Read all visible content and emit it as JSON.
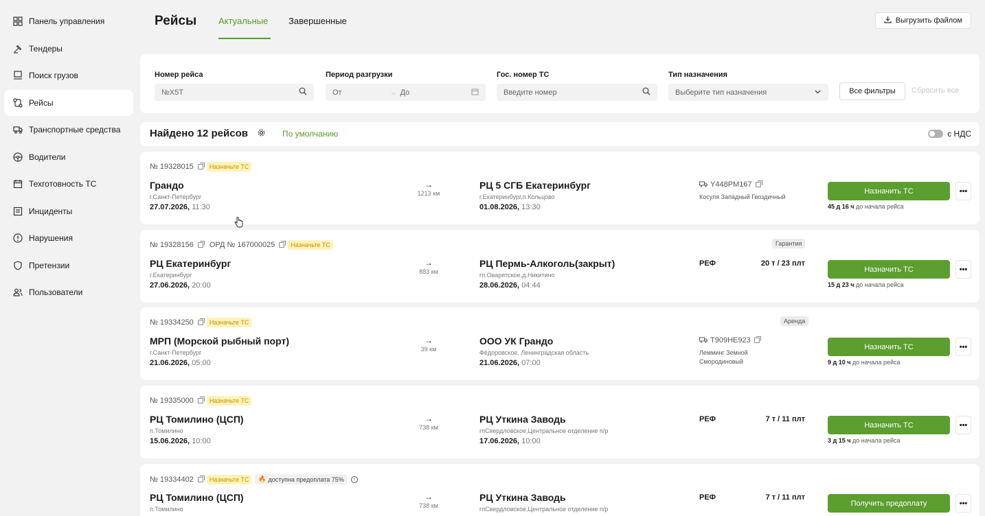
{
  "sidebar": {
    "items": [
      {
        "label": "Панель управления",
        "icon": "grid-icon"
      },
      {
        "label": "Тендеры",
        "icon": "gavel-icon"
      },
      {
        "label": "Поиск грузов",
        "icon": "monitor-icon"
      },
      {
        "label": "Рейсы",
        "icon": "route-icon"
      },
      {
        "label": "Транспортные средства",
        "icon": "truck-icon"
      },
      {
        "label": "Водители",
        "icon": "steering-wheel-icon"
      },
      {
        "label": "Техготовность ТС",
        "icon": "calendar-icon"
      },
      {
        "label": "Инциденты",
        "icon": "list-icon"
      },
      {
        "label": "Нарушения",
        "icon": "alert-icon"
      },
      {
        "label": "Претензии",
        "icon": "shield-icon"
      },
      {
        "label": "Пользователи",
        "icon": "users-icon"
      }
    ]
  },
  "header": {
    "title": "Рейсы",
    "tabs": [
      {
        "label": "Актуальные"
      },
      {
        "label": "Завершенные"
      }
    ],
    "export_label": "Выгрузить файлом"
  },
  "filters": {
    "trip_number": {
      "label": "Номер рейса",
      "value": "№X5T"
    },
    "unload_period": {
      "label": "Период разгрузки",
      "from": "От",
      "to": "До"
    },
    "vehicle_number": {
      "label": "Гос. номер ТС",
      "placeholder": "Введите номер"
    },
    "assignment_type": {
      "label": "Тип назначения",
      "placeholder": "Выберите тип назначения"
    },
    "all_filters": "Все фильтры",
    "reset": "Сбросить все"
  },
  "results": {
    "found": "Найдено 12 рейсов",
    "sort": "По умолчанию",
    "vat": "с НДС"
  },
  "trips": [
    {
      "number": "№ 19328015",
      "status": "Назначьте ТС",
      "from_city": "Грандо",
      "from_sub": "г.Санкт-Петербург",
      "from_date": "27.07.2026,",
      "from_time": "11:30",
      "distance": "1213 км",
      "to_city": "РЦ 5 СГБ Екатеринбург",
      "to_sub": "г.Екатеринбург,п.Кольцово",
      "to_date": "01.08.2026,",
      "to_time": "13:30",
      "plate": "Y448PM167",
      "driver": "Косуля Западный Гвоздичный",
      "action": "Назначить ТС",
      "countdown_value": "45 д 16 ч",
      "countdown_text": "до начала рейса"
    },
    {
      "number": "№ 19328156",
      "ord": "ОРД № 167000025",
      "status": "Назначьте ТС",
      "tag": "Гарантия",
      "from_city": "РЦ Екатеринбург",
      "from_sub": "г.Екатеринбург",
      "from_date": "27.06.2026,",
      "from_time": "20:00",
      "distance": "883 км",
      "to_city": "РЦ Пермь-Алкоголь(закрыт)",
      "to_sub": "гп.Оварятское,д.Никитино",
      "to_date": "28.06.2026,",
      "to_time": "04:44",
      "ref": "РЕФ",
      "capacity": "20 т / 23 плт",
      "action": "Назначить ТС",
      "countdown_value": "15 д 23 ч",
      "countdown_text": "до начала рейса"
    },
    {
      "number": "№ 19334250",
      "status": "Назначьте ТС",
      "tag": "Аренда",
      "from_city": "МРП (Морской рыбный порт)",
      "from_sub": "г.Санкт-Петербург",
      "from_date": "21.06.2026,",
      "from_time": "05:00",
      "distance": "39 км",
      "to_city": "ООО УК Грандо",
      "to_sub": "Фёдоровское, Ленинградская область",
      "to_date": "21.06.2026,",
      "to_time": "07:00",
      "plate": "T909HE923",
      "driver": "Лемминг Земной Смородиновый",
      "action": "Назначить ТС",
      "countdown_value": "9 д 10 ч",
      "countdown_text": "до начала рейса"
    },
    {
      "number": "№ 19335000",
      "status": "Назначьте ТС",
      "from_city": "РЦ Томилино (ЦСП)",
      "from_sub": "п.Томилино",
      "from_date": "15.06.2026,",
      "from_time": "10:00",
      "distance": "738 км",
      "to_city": "РЦ Уткина Заводь",
      "to_sub": "гпСвердловское,Центральное отделение п/р",
      "to_date": "17.06.2026,",
      "to_time": "10:00",
      "ref": "РЕФ",
      "capacity": "7 т / 11 плт",
      "action": "Назначить ТС",
      "countdown_value": "3 д 15 ч",
      "countdown_text": "до начала рейса"
    },
    {
      "number": "№ 19334402",
      "status": "Назначьте ТС",
      "prepay": "доступна предоплата 75%",
      "from_city": "РЦ Томилино (ЦСП)",
      "from_sub": "п.Томилино",
      "distance": "738 км",
      "to_city": "РЦ Уткина Заводь",
      "to_sub": "гпСвердловское,Центральное отделение п/р",
      "ref": "РЕФ",
      "capacity": "7 т / 11 плт",
      "action": "Получить предоплату"
    }
  ],
  "more_label": "•••",
  "colors": {
    "accent": "#5c9e30",
    "badge_bg": "#fff3b8",
    "badge_text": "#c98f00"
  }
}
